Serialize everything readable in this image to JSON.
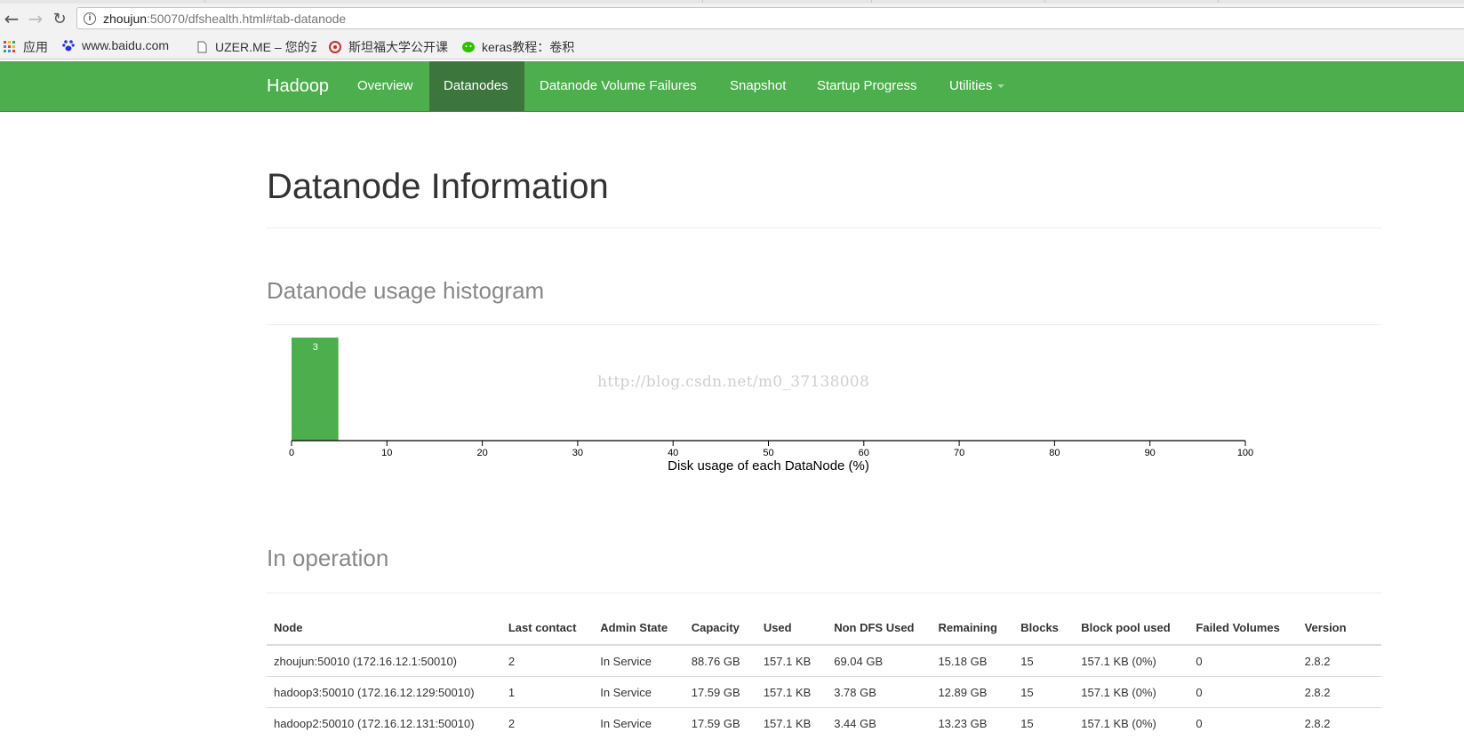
{
  "browser": {
    "url_host": "zhoujun",
    "url_rest": ":50070/dfshealth.html#tab-datanode",
    "bookmarks": [
      {
        "label": "应用",
        "icon": "apps-grid-icon"
      },
      {
        "label": "www.baidu.com",
        "icon": "baidu-paw-icon"
      },
      {
        "label": "UZER.ME – 您的云",
        "icon": "page-icon"
      },
      {
        "label": "斯坦福大学公开课",
        "icon": "netease-icon"
      },
      {
        "label": "keras教程：卷积",
        "icon": "wechat-icon"
      }
    ]
  },
  "navbar": {
    "brand": "Hadoop",
    "items": [
      {
        "label": "Overview"
      },
      {
        "label": "Datanodes",
        "active": true
      },
      {
        "label": "Datanode Volume Failures"
      },
      {
        "label": "Snapshot"
      },
      {
        "label": "Startup Progress"
      },
      {
        "label": "Utilities",
        "dropdown": true
      }
    ]
  },
  "page": {
    "title": "Datanode Information",
    "histogram_heading": "Datanode usage histogram",
    "operation_heading": "In operation",
    "watermark": "http://blog.csdn.net/m0_37138008"
  },
  "chart_data": {
    "type": "bar",
    "xlabel": "Disk usage of each DataNode (%)",
    "xlim": [
      0,
      100
    ],
    "xticks": [
      0,
      10,
      20,
      30,
      40,
      50,
      60,
      70,
      80,
      90,
      100
    ],
    "bins": [
      {
        "from": 0,
        "to": 5,
        "count": 3,
        "label": "3"
      }
    ],
    "color": "#4cae4c"
  },
  "table": {
    "headers": [
      "Node",
      "Last contact",
      "Admin State",
      "Capacity",
      "Used",
      "Non DFS Used",
      "Remaining",
      "Blocks",
      "Block pool used",
      "Failed Volumes",
      "Version"
    ],
    "rows": [
      [
        "zhoujun:50010 (172.16.12.1:50010)",
        "2",
        "In Service",
        "88.76 GB",
        "157.1 KB",
        "69.04 GB",
        "15.18 GB",
        "15",
        "157.1 KB (0%)",
        "0",
        "2.8.2"
      ],
      [
        "hadoop3:50010 (172.16.12.129:50010)",
        "1",
        "In Service",
        "17.59 GB",
        "157.1 KB",
        "3.78 GB",
        "12.89 GB",
        "15",
        "157.1 KB (0%)",
        "0",
        "2.8.2"
      ],
      [
        "hadoop2:50010 (172.16.12.131:50010)",
        "2",
        "In Service",
        "17.59 GB",
        "157.1 KB",
        "3.44 GB",
        "13.23 GB",
        "15",
        "157.1 KB (0%)",
        "0",
        "2.8.2"
      ]
    ]
  }
}
